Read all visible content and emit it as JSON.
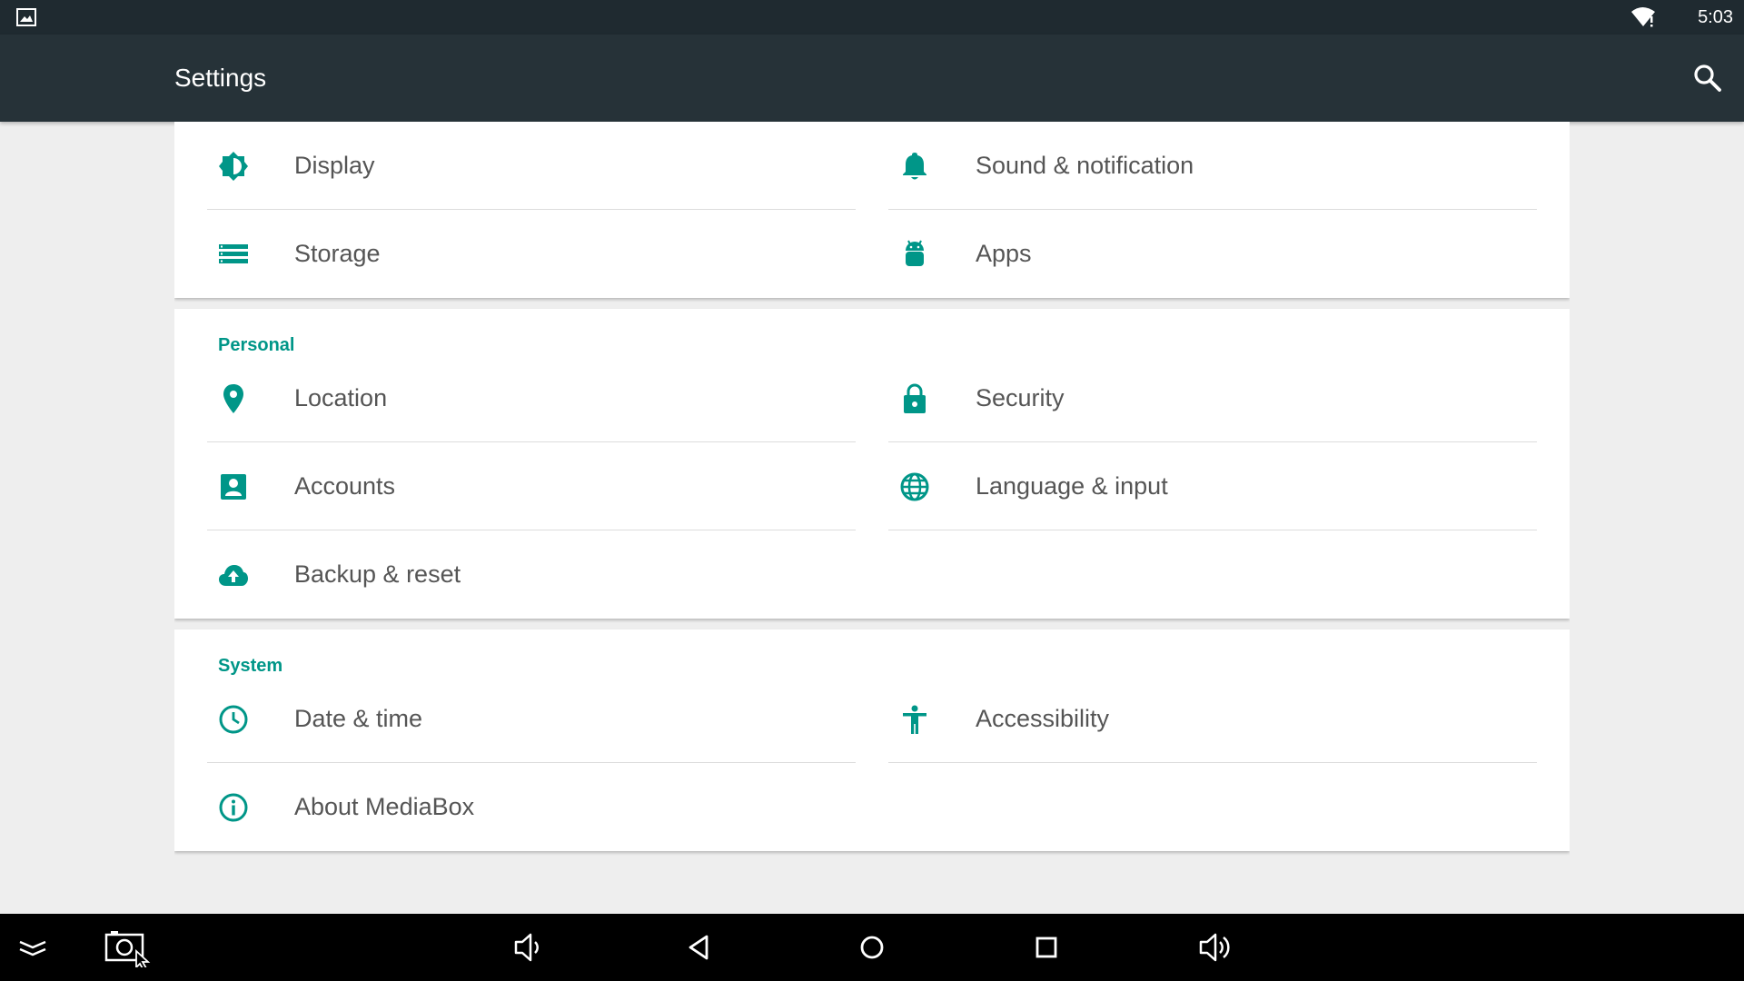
{
  "status_bar": {
    "time": "5:03",
    "left_icon": "gallery-icon",
    "right_icon": "wifi-icon"
  },
  "app_bar": {
    "title": "Settings",
    "action_icon": "search-icon"
  },
  "colors": {
    "accent": "#009688",
    "app_bar": "#263238",
    "status_bar": "#1f2a30",
    "background": "#eeeeee",
    "text": "#555555"
  },
  "sections": [
    {
      "title": "",
      "items": [
        {
          "label": "Display",
          "icon": "brightness-icon"
        },
        {
          "label": "Sound & notification",
          "icon": "bell-icon"
        },
        {
          "label": "Storage",
          "icon": "storage-icon"
        },
        {
          "label": "Apps",
          "icon": "android-icon"
        }
      ]
    },
    {
      "title": "Personal",
      "items": [
        {
          "label": "Location",
          "icon": "location-pin-icon"
        },
        {
          "label": "Security",
          "icon": "lock-icon"
        },
        {
          "label": "Accounts",
          "icon": "account-icon"
        },
        {
          "label": "Language & input",
          "icon": "globe-icon"
        },
        {
          "label": "Backup & reset",
          "icon": "cloud-upload-icon"
        }
      ]
    },
    {
      "title": "System",
      "items": [
        {
          "label": "Date & time",
          "icon": "clock-icon"
        },
        {
          "label": "Accessibility",
          "icon": "accessibility-icon"
        },
        {
          "label": "About MediaBox",
          "icon": "info-icon"
        }
      ]
    }
  ],
  "nav_bar": {
    "buttons": [
      "hide-bar-icon",
      "screenshot-icon",
      "volume-down-icon",
      "back-icon",
      "home-icon",
      "recents-icon",
      "volume-up-icon"
    ]
  }
}
